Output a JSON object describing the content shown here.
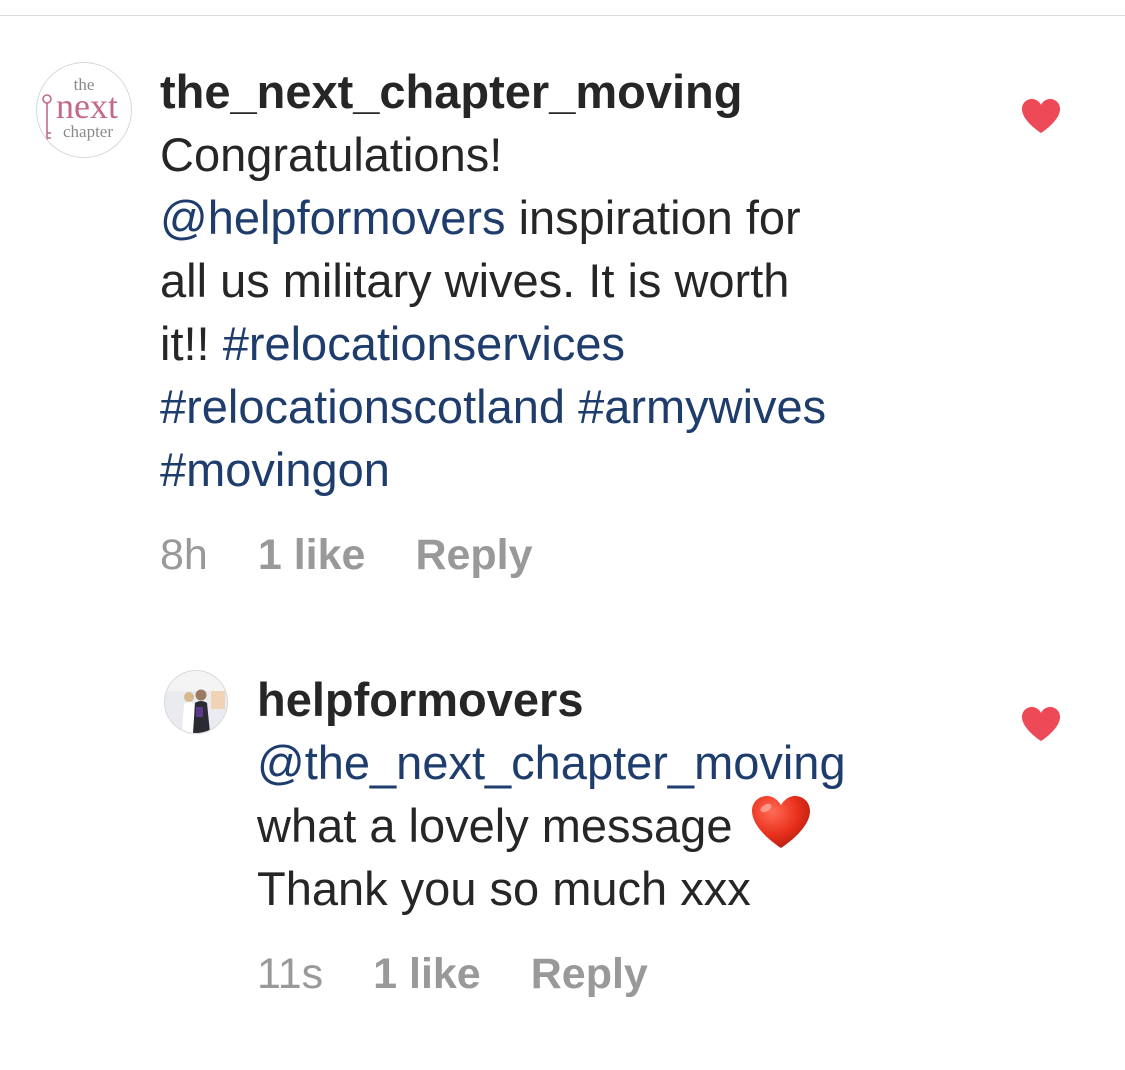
{
  "comments": [
    {
      "username": "the_next_chapter_moving",
      "avatar": {
        "type": "logo",
        "logo_text": [
          "the",
          "next",
          "chapter"
        ]
      },
      "lines": [
        [
          {
            "kind": "text",
            "value": "Congratulations!"
          }
        ],
        [
          {
            "kind": "mention",
            "value": "@helpformovers"
          },
          {
            "kind": "text",
            "value": " inspiration for"
          }
        ],
        [
          {
            "kind": "text",
            "value": "all us military wives. It is worth"
          }
        ],
        [
          {
            "kind": "text",
            "value": "it!! "
          },
          {
            "kind": "hashtag",
            "value": "#relocationservices"
          }
        ],
        [
          {
            "kind": "hashtag",
            "value": "#relocationscotland"
          },
          {
            "kind": "text",
            "value": " "
          },
          {
            "kind": "hashtag",
            "value": "#armywives"
          }
        ],
        [
          {
            "kind": "hashtag",
            "value": "#movingon"
          }
        ]
      ],
      "time": "8h",
      "likes": "1 like",
      "reply_label": "Reply",
      "liked": true
    },
    {
      "username": "helpformovers",
      "avatar": {
        "type": "photo"
      },
      "lines": [
        [
          {
            "kind": "mention",
            "value": "@the_next_chapter_moving"
          }
        ],
        [
          {
            "kind": "text",
            "value": "what a lovely message "
          },
          {
            "kind": "emoji",
            "value": "red-heart-emoji"
          }
        ],
        [
          {
            "kind": "text",
            "value": "Thank you so much xxx"
          }
        ]
      ],
      "time": "11s",
      "likes": "1 like",
      "reply_label": "Reply",
      "liked": true
    }
  ],
  "colors": {
    "link": "#1e3d6d",
    "text": "#262626",
    "meta": "#999999",
    "like_heart": "#ed4956",
    "divider": "#dbdbdb",
    "logo_pink": "#c26a87"
  },
  "icons": {
    "like": "heart-filled-icon"
  }
}
